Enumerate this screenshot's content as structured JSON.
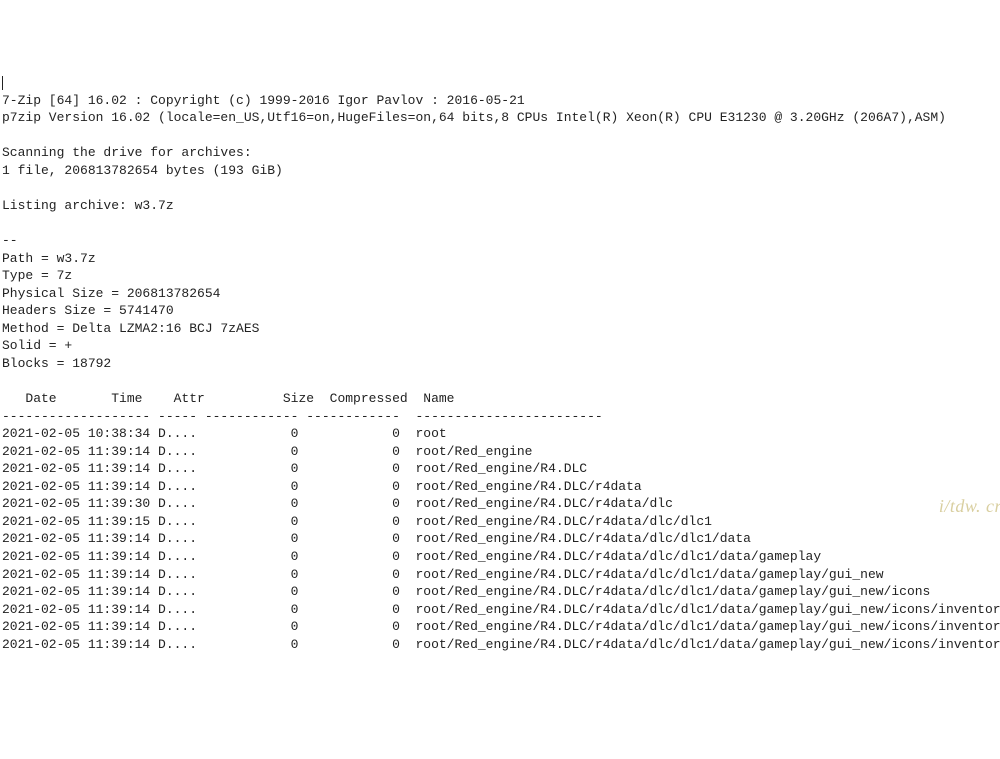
{
  "header": {
    "line1": "7-Zip [64] 16.02 : Copyright (c) 1999-2016 Igor Pavlov : 2016-05-21",
    "line2": "p7zip Version 16.02 (locale=en_US,Utf16=on,HugeFiles=on,64 bits,8 CPUs Intel(R) Xeon(R) CPU E31230 @ 3.20GHz (206A7),ASM)"
  },
  "scan": {
    "line1": "Scanning the drive for archives:",
    "line2": "1 file, 206813782654 bytes (193 GiB)"
  },
  "listing_line": "Listing archive: w3.7z",
  "dashes": "--",
  "meta": {
    "path": "Path = w3.7z",
    "type": "Type = 7z",
    "physical_size": "Physical Size = 206813782654",
    "headers_size": "Headers Size = 5741470",
    "method": "Method = Delta LZMA2:16 BCJ 7zAES",
    "solid": "Solid = +",
    "blocks": "Blocks = 18792"
  },
  "columns": {
    "date": "   Date   ",
    "time": "   Time  ",
    "attr": " Attr  ",
    "size": "       Size",
    "compressed": " Compressed",
    "name": " Name"
  },
  "sep": {
    "date": "-------------------",
    "attr": "-----",
    "size": "------------",
    "compressed": "------------",
    "name": "------------------------"
  },
  "rows": [
    {
      "date": "2021-02-05",
      "time": "10:38:34",
      "attr": "D....",
      "size": "0",
      "compressed": "0",
      "name": "root"
    },
    {
      "date": "2021-02-05",
      "time": "11:39:14",
      "attr": "D....",
      "size": "0",
      "compressed": "0",
      "name": "root/Red_engine"
    },
    {
      "date": "2021-02-05",
      "time": "11:39:14",
      "attr": "D....",
      "size": "0",
      "compressed": "0",
      "name": "root/Red_engine/R4.DLC"
    },
    {
      "date": "2021-02-05",
      "time": "11:39:14",
      "attr": "D....",
      "size": "0",
      "compressed": "0",
      "name": "root/Red_engine/R4.DLC/r4data"
    },
    {
      "date": "2021-02-05",
      "time": "11:39:30",
      "attr": "D....",
      "size": "0",
      "compressed": "0",
      "name": "root/Red_engine/R4.DLC/r4data/dlc"
    },
    {
      "date": "2021-02-05",
      "time": "11:39:15",
      "attr": "D....",
      "size": "0",
      "compressed": "0",
      "name": "root/Red_engine/R4.DLC/r4data/dlc/dlc1"
    },
    {
      "date": "2021-02-05",
      "time": "11:39:14",
      "attr": "D....",
      "size": "0",
      "compressed": "0",
      "name": "root/Red_engine/R4.DLC/r4data/dlc/dlc1/data"
    },
    {
      "date": "2021-02-05",
      "time": "11:39:14",
      "attr": "D....",
      "size": "0",
      "compressed": "0",
      "name": "root/Red_engine/R4.DLC/r4data/dlc/dlc1/data/gameplay"
    },
    {
      "date": "2021-02-05",
      "time": "11:39:14",
      "attr": "D....",
      "size": "0",
      "compressed": "0",
      "name": "root/Red_engine/R4.DLC/r4data/dlc/dlc1/data/gameplay/gui_new"
    },
    {
      "date": "2021-02-05",
      "time": "11:39:14",
      "attr": "D....",
      "size": "0",
      "compressed": "0",
      "name": "root/Red_engine/R4.DLC/r4data/dlc/dlc1/data/gameplay/gui_new/icons"
    },
    {
      "date": "2021-02-05",
      "time": "11:39:14",
      "attr": "D....",
      "size": "0",
      "compressed": "0",
      "name": "root/Red_engine/R4.DLC/r4data/dlc/dlc1/data/gameplay/gui_new/icons/inventory"
    },
    {
      "date": "2021-02-05",
      "time": "11:39:14",
      "attr": "D....",
      "size": "0",
      "compressed": "0",
      "name": "root/Red_engine/R4.DLC/r4data/dlc/dlc1/data/gameplay/gui_new/icons/inventory/armors"
    },
    {
      "date": "2021-02-05",
      "time": "11:39:14",
      "attr": "D....",
      "size": "0",
      "compressed": "0",
      "name": "root/Red_engine/R4.DLC/r4data/dlc/dlc1/data/gameplay/gui_new/icons/inventory/armors"
    }
  ],
  "watermark": "i/tdw. cr"
}
